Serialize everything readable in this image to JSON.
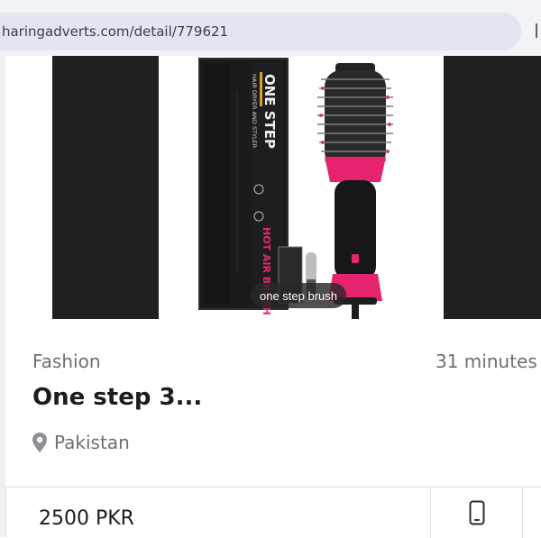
{
  "browser": {
    "url": "haringadverts.com/detail/779621"
  },
  "carousel": {
    "caption": "one step brush",
    "package_text": {
      "brand": "ONE STEP",
      "subtitle": "HAIR DRYER AND STYLER",
      "product": "HOT AIR BRUSH"
    }
  },
  "listing": {
    "category": "Fashion",
    "time_ago": "31 minutes",
    "title": "One step 3...",
    "location": "Pakistan",
    "price": "2500 PKR"
  },
  "icons": {
    "location": "map-pin-icon",
    "phone": "phone-icon"
  },
  "colors": {
    "accent_pink": "#e6246e",
    "dark_panel": "#202020",
    "muted_text": "#6e6e73"
  }
}
